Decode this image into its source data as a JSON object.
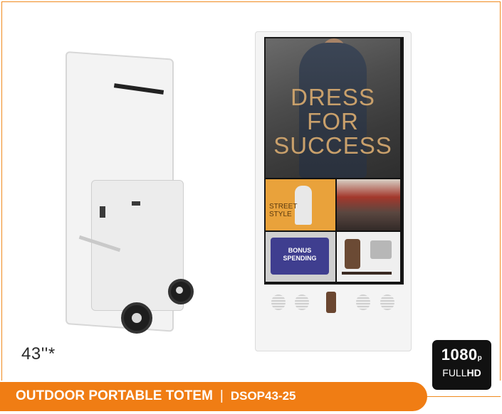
{
  "product": {
    "size_label": "43''*",
    "banner_title": "OUTDOOR PORTABLE TOTEM",
    "banner_separator": "|",
    "banner_code": "DSOP43-25"
  },
  "badge": {
    "resolution": "1080",
    "resolution_suffix": "p",
    "sub_prefix": "FULL",
    "sub_bold": "HD"
  },
  "screen": {
    "headline_line1": "DRESS FOR",
    "headline_line2": "SUCCESS",
    "tile1_line1": "STREET",
    "tile1_line2": "STYLE",
    "card_line1": "BONUS",
    "card_line2": "SPENDING"
  },
  "colors": {
    "accent": "#f07d14",
    "headline": "#c9a06b",
    "card": "#3f3e8f"
  }
}
